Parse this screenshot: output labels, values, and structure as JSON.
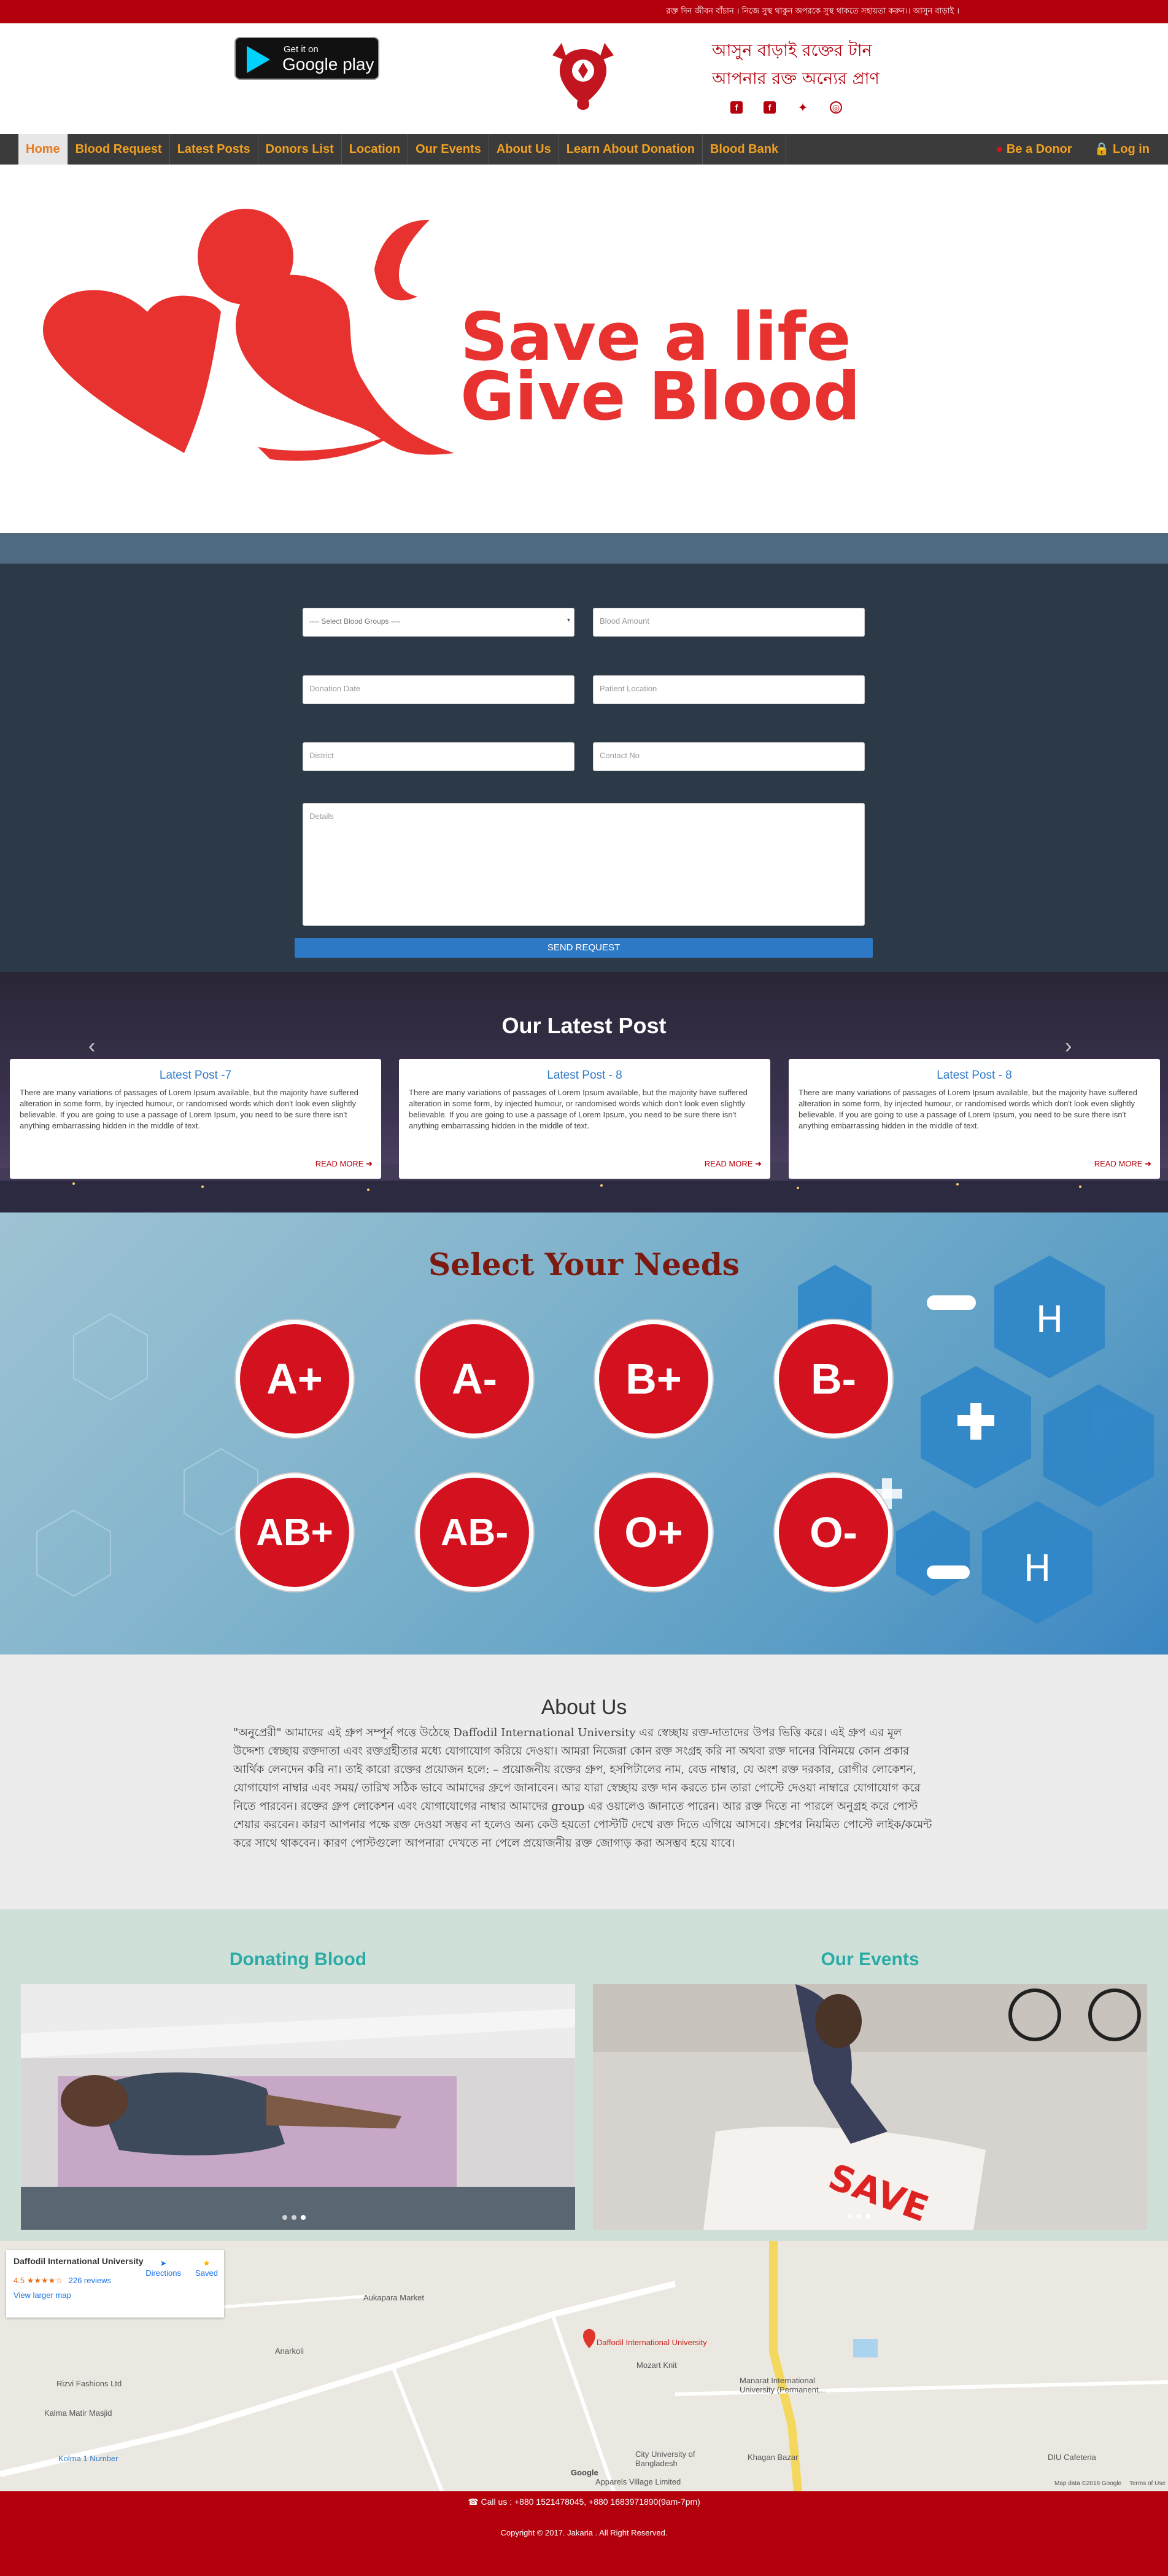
{
  "topbar": {
    "text": "রক্ত দিন জীবন বাঁচান । নিজে সুস্থ থাকুন অপরকে সুস্থ থাকতে সহায়তা করুন।। আসুন বাড়াই ।"
  },
  "header": {
    "gplay_small": "Get it on",
    "gplay_big": "Google play",
    "tagline1": "আসুন বাড়াই রক্তের টান",
    "tagline2": "আপনার রক্ত অন্যের প্রাণ",
    "social": [
      "f",
      "f",
      "t",
      "o"
    ]
  },
  "nav": {
    "items": [
      "Home",
      "Blood Request",
      "Latest Posts",
      "Donors List",
      "Location",
      "Our Events",
      "About Us",
      "Learn About Donation",
      "Blood Bank"
    ],
    "donor": "Be a Donor",
    "login": "Log in"
  },
  "hero": {
    "line1": "Save a life",
    "line2": "Give Blood"
  },
  "form": {
    "select_placeholder": "---- Select Blood Groups ----",
    "amount": "Blood Amount",
    "date": "Donation Date",
    "location": "Patient Location",
    "district": "District",
    "contact": "Contact No",
    "details": "Details",
    "send": "SEND REQUEST"
  },
  "posts": {
    "heading": "Our Latest Post",
    "items": [
      {
        "title": "Latest Post -7",
        "body": "There are many variations of passages of Lorem Ipsum available, but the majority have suffered alteration in some form, by injected humour, or randomised words which don't look even slightly believable. If you are going to use a passage of Lorem Ipsum, you need to be sure there isn't anything embarrassing hidden in the middle of text.",
        "more": "READ MORE"
      },
      {
        "title": "Latest Post - 8",
        "body": "There are many variations of passages of Lorem Ipsum available, but the majority have suffered alteration in some form, by injected humour, or randomised words which don't look even slightly believable. If you are going to use a passage of Lorem Ipsum, you need to be sure there isn't anything embarrassing hidden in the middle of text.",
        "more": "READ MORE"
      },
      {
        "title": "Latest Post - 8",
        "body": "There are many variations of passages of Lorem Ipsum available, but the majority have suffered alteration in some form, by injected humour, or randomised words which don't look even slightly believable. If you are going to use a passage of Lorem Ipsum, you need to be sure there isn't anything embarrassing hidden in the middle of text.",
        "more": "READ MORE"
      }
    ]
  },
  "needs": {
    "heading": "Select Your Needs",
    "groups": [
      "A+",
      "A-",
      "B+",
      "B-",
      "AB+",
      "AB-",
      "O+",
      "O-"
    ]
  },
  "about": {
    "heading": "About Us",
    "body": "\"অনুপ্রেরী\" আমাদের এই গ্রুপ সম্পূর্ন পত্তে উঠেছে Daffodil International University এর স্বেচ্ছায় রক্ত-দাতাদের উপর ভিত্তি করে। এই গ্রুপ এর মূল উদ্দেশ্য স্বেচ্ছায় রক্তদাতা এবং রক্তগ্রহীতার মধ্যে যোগাযোগ করিয়ে দেওয়া। আমরা নিজেরা কোন রক্ত সংগ্রহ করি না অথবা রক্ত দানের বিনিময়ে কোন প্রকার আর্থিক লেনদেন করি না। তাই কারো রক্তের প্রয়োজন হলে: – প্রয়োজনীয় রক্তের গ্রুপ, হসপিটালের নাম, বেড নাম্বার, যে অংশ রক্ত দরকার, রোগীর লোকেশন, যোগাযোগ নাম্বার এবং সময়/ তারিখ সঠিক ভাবে আমাদের গ্রুপে জানাবেন। আর যারা স্বেচ্ছায় রক্ত দান করতে চান তারা পোস্টে দেওয়া নাম্বারে যোগাযোগ করে নিতে পারবেন। রক্তের গ্রুপ লোকেশন এবং যোগাযোগের নাম্বার আমাদের group এর ওয়ালেও জানাতে পারেন। আর রক্ত দিতে না পারলে অনুগ্রহ করে পোস্ট শেয়ার করবেন। কারণ আপনার পক্ষে রক্ত দেওয়া সম্ভব না হলেও অন্য কেউ হয়তো পোস্টটি দেখে রক্ত দিতে এগিয়ে আসবে। গ্রুপের নিয়মিত পোস্টে লাইক/কমেন্ট করে সাথে থাকবেন। কারণ পোস্টগুলো আপনারা দেখতে না পেলে প্রয়োজনীয় রক্ত জোগাড় করা অসম্ভব হয়ে যাবে।"
  },
  "gallery": {
    "left": "Donating Blood",
    "right": "Our Events"
  },
  "map": {
    "place": "Daffodil International University",
    "rating": "4.5",
    "reviews": "226 reviews",
    "larger": "View larger map",
    "directions": "Directions",
    "save": "Saved",
    "labels": {
      "pin": "Daffodil International University",
      "aukapara": "Aukapara Market",
      "anarkoli": "Anarkoli",
      "rizvi": "Rizvi Fashions Ltd",
      "kalma": "Kalma Matir Masjid",
      "kolma": "Kolma 1 Number",
      "mozart": "Mozart Knit",
      "manarat": "Manarat International University (Permanent...",
      "city": "City University of Bangladesh",
      "apparels": "Apparels Village Limited",
      "khagan": "Khagan Bazar",
      "diu": "DIU Cafeteria",
      "google": "Google",
      "mapdata": "Map data ©2018 Google",
      "terms": "Terms of Use"
    }
  },
  "footer": {
    "call": "Call us : +880 1521478045, +880 1683971890(9am-7pm)",
    "copyright": "Copyright © 2017. Jakaria . All Right Reserved."
  },
  "colors": {
    "brand_red": "#b3000c",
    "nav_bg": "#3b3b3b",
    "nav_text": "#f0a020",
    "send_blue": "#2e79c6"
  }
}
